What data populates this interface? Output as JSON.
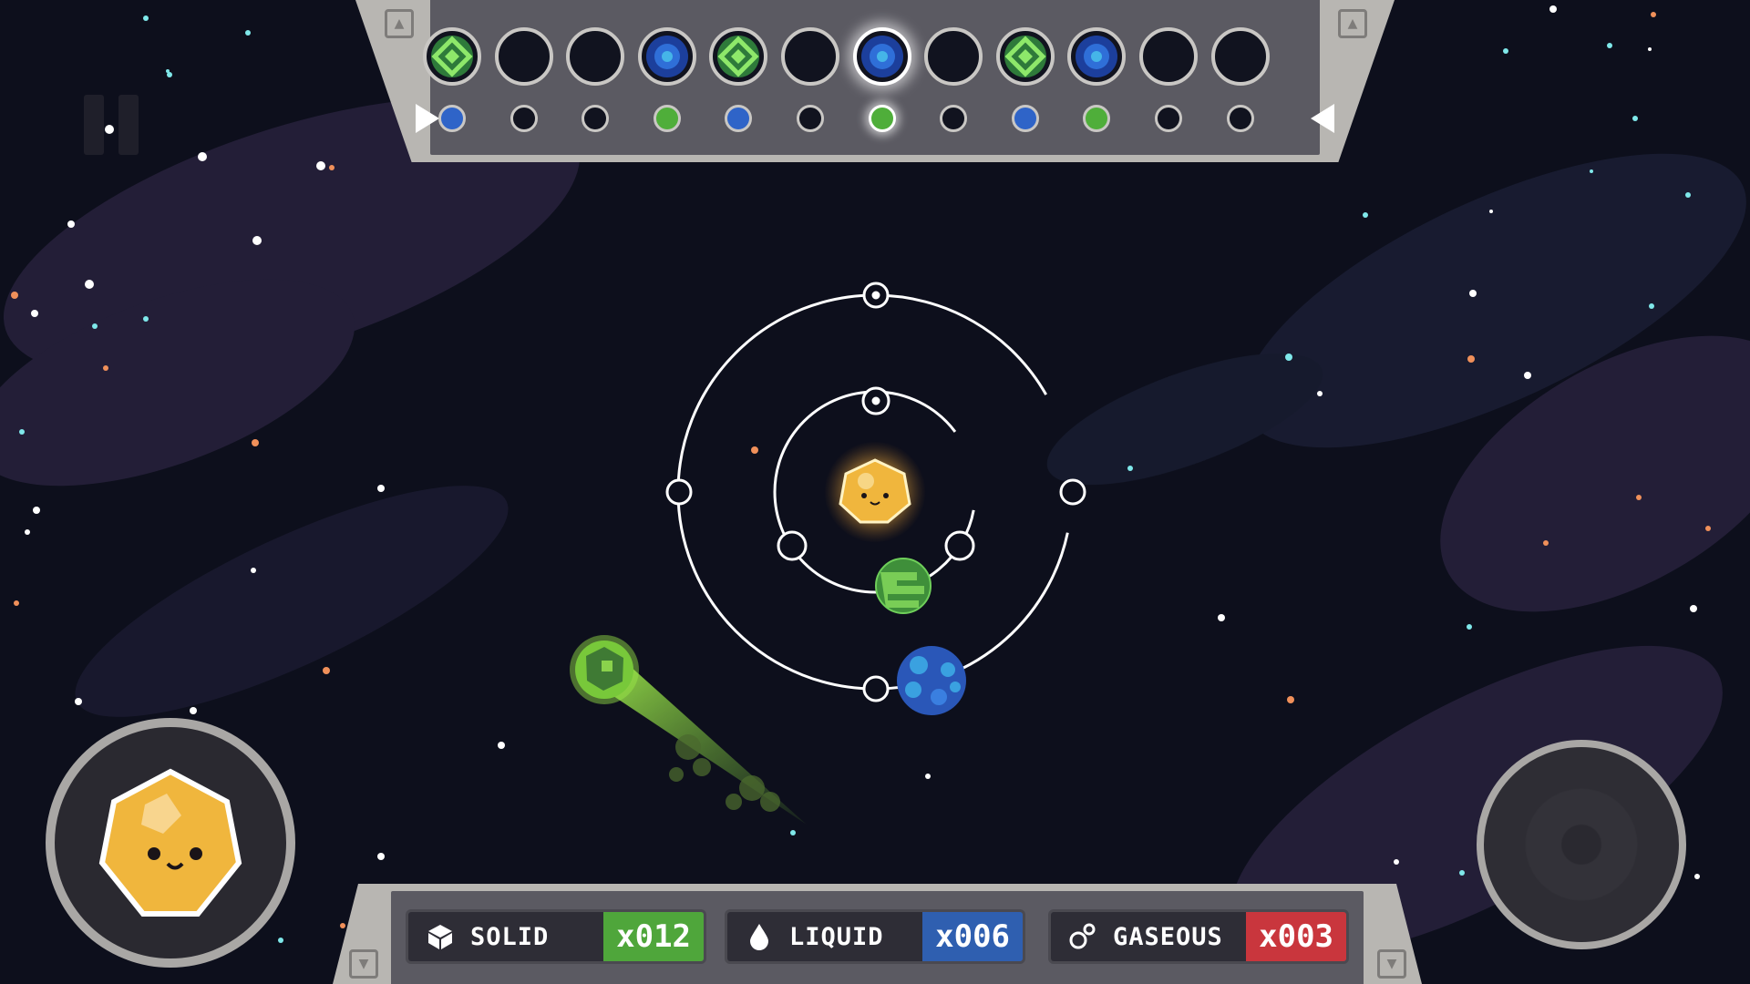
{
  "game": {
    "timeline": {
      "slots": [
        {
          "kind": "green-diamond",
          "active": false
        },
        {
          "kind": "empty",
          "active": false
        },
        {
          "kind": "empty",
          "active": false
        },
        {
          "kind": "blue-orb",
          "active": false
        },
        {
          "kind": "green-diamond",
          "active": false
        },
        {
          "kind": "empty",
          "active": false
        },
        {
          "kind": "blue-orb",
          "active": true
        },
        {
          "kind": "empty",
          "active": false
        },
        {
          "kind": "green-diamond",
          "active": false
        },
        {
          "kind": "blue-orb",
          "active": false
        },
        {
          "kind": "empty",
          "active": false
        },
        {
          "kind": "empty",
          "active": false
        }
      ],
      "dots": [
        "blue",
        "empty",
        "empty",
        "green",
        "blue",
        "empty",
        "green",
        "empty",
        "blue",
        "green",
        "empty",
        "empty"
      ],
      "active_index": 6
    },
    "resources": {
      "solid": {
        "label": "SOLID",
        "count": "x012",
        "color": "#4fa63b",
        "icon": "cube-icon"
      },
      "liquid": {
        "label": "LIQUID",
        "count": "x006",
        "color": "#2f5fb0",
        "icon": "droplet-icon"
      },
      "gaseous": {
        "label": "GASEOUS",
        "count": "x003",
        "color": "#c9363d",
        "icon": "bubbles-icon"
      }
    },
    "orbits": [
      {
        "name": "inner",
        "slots": 4
      },
      {
        "name": "outer",
        "slots": 5
      }
    ],
    "colors": {
      "space": "#0d0f1c",
      "panel": "#5b5a62",
      "panel_frame": "#b8b6b2",
      "sun": "#f0b63d",
      "green": "#6fd049",
      "blue": "#2f64c8"
    },
    "icons": [
      "pause-icon",
      "up-arrow-icon",
      "down-arrow-icon",
      "play-marker-icon"
    ]
  }
}
